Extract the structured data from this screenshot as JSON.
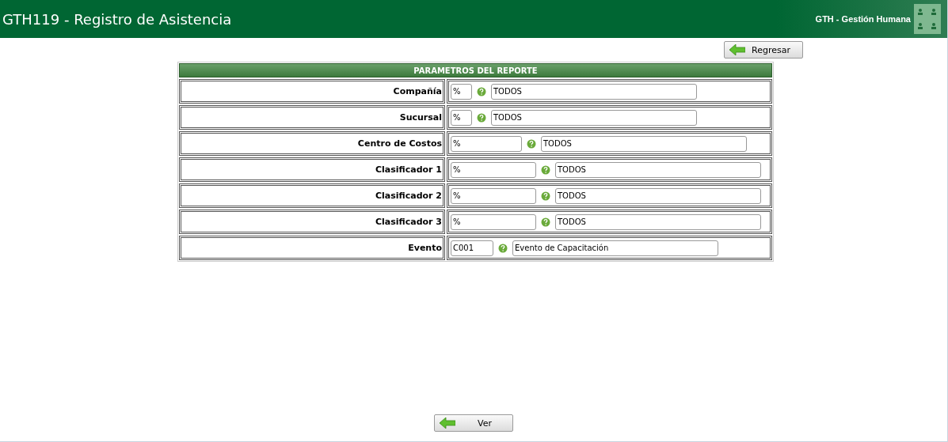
{
  "header": {
    "title": "GTH119 - Registro de Asistencia",
    "module": "GTH - Gestión Humana"
  },
  "back_button": {
    "label": "Regresar"
  },
  "form": {
    "title": "PARAMETROS DEL REPORTE",
    "rows": [
      {
        "label": "Compañía",
        "code": "%",
        "kind": "short",
        "description": "TODOS"
      },
      {
        "label": "Sucursal",
        "code": "%",
        "kind": "short",
        "description": "TODOS"
      },
      {
        "label": "Centro de Costos",
        "code": "%",
        "kind": "medium",
        "description": "TODOS"
      },
      {
        "label": "Clasificador 1",
        "code": "%",
        "kind": "wide",
        "description": "TODOS"
      },
      {
        "label": "Clasificador 2",
        "code": "%",
        "kind": "wide",
        "description": "TODOS"
      },
      {
        "label": "Clasificador 3",
        "code": "%",
        "kind": "wide",
        "description": "TODOS"
      },
      {
        "label": "Evento",
        "code": "C001",
        "kind": "compact",
        "description": "Evento de Capacitación"
      }
    ]
  },
  "view_button": {
    "label": "Ver"
  }
}
